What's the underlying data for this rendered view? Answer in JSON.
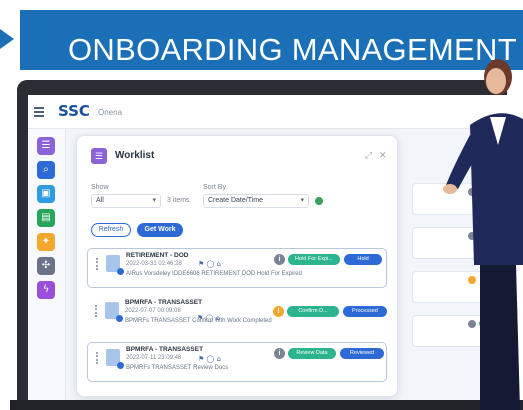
{
  "banner": {
    "title": "ONBOARDING MANAGEMENT"
  },
  "app": {
    "logo": "SSC",
    "logo_sub": "Onena"
  },
  "rail": {
    "items": [
      {
        "icon": "list-icon",
        "glyph": "☰",
        "color": "#8a63d8"
      },
      {
        "icon": "search-icon",
        "glyph": "⌕",
        "color": "#2d6ad6"
      },
      {
        "icon": "briefcase-icon",
        "glyph": "▣",
        "color": "#2f9be0"
      },
      {
        "icon": "save-icon",
        "glyph": "▤",
        "color": "#28a55a"
      },
      {
        "icon": "person-badge-icon",
        "glyph": "✦",
        "color": "#f1a82c"
      },
      {
        "icon": "apps-icon",
        "glyph": "✣",
        "color": "#6b7388"
      },
      {
        "icon": "lightning-icon",
        "glyph": "ϟ",
        "color": "#9b4fd8"
      }
    ]
  },
  "worklist": {
    "title": "Worklist",
    "show_label": "Show",
    "show_value": "All",
    "items_count": "3 items",
    "sort_label": "Sort By",
    "sort_value": "Create Date/Time",
    "refresh_label": "Refresh",
    "get_work_label": "Get Work",
    "rows": [
      {
        "title": "RETIREMENT - DOD",
        "date": "2022-03-31 02:46:28",
        "detail": "AIRus  Vorsdeley  IDDE6606  RETIREMENT  DOD  Hold For Expired",
        "status_color": "#7b8494",
        "status_glyph": "i",
        "pill1": "Hold For Expi...",
        "pill1_color": "#2cb48e",
        "pill2": "Hold",
        "pill2_color": "#2d6ad6",
        "highlight": true
      },
      {
        "title": "BPMRFA - TRANSASSET",
        "date": "2022-07-07 00:09:08",
        "detail": "BPMRFs  TRANSASSET  Confirm Wth Work Completed",
        "status_color": "#f1a82c",
        "status_glyph": "!",
        "pill1": "Confirm D...",
        "pill1_color": "#2cb48e",
        "pill2": "Processed",
        "pill2_color": "#2d6ad6",
        "highlight": false
      },
      {
        "title": "BPMRFA - TRANSASSET",
        "date": "2022-07-11 23:09:48",
        "detail": "BPMRFs  TRANSASSET  Review Docs",
        "status_color": "#7b8494",
        "status_glyph": "i",
        "pill1": "Review Data",
        "pill1_color": "#2cb48e",
        "pill2": "Reviewed",
        "pill2_color": "#2d6ad6",
        "highlight": true
      }
    ]
  },
  "colors": {
    "banner_blue": "#1a6fb6",
    "accent_blue": "#2d6ad6",
    "accent_green": "#2cb48e",
    "presenter_suit": "#1f2a5a"
  }
}
